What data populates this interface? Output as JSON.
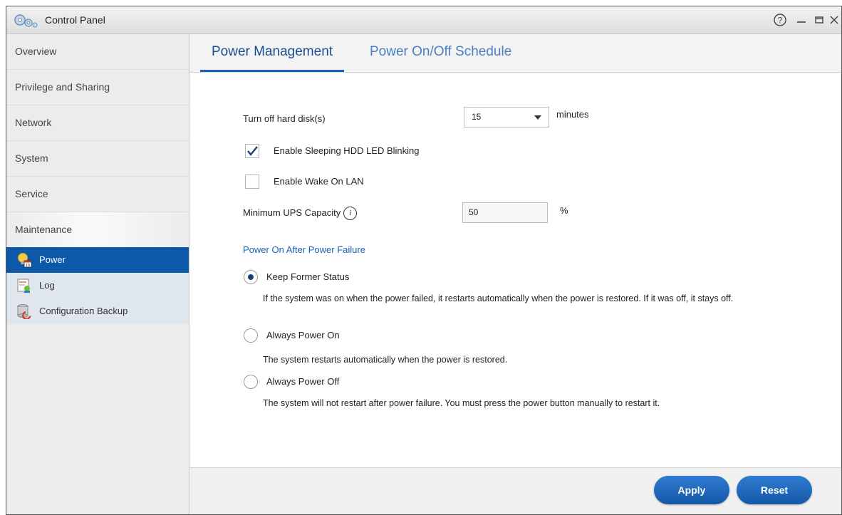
{
  "window": {
    "title": "Control Panel"
  },
  "sidebar": {
    "items": [
      {
        "label": "Overview"
      },
      {
        "label": "Privilege and Sharing"
      },
      {
        "label": "Network"
      },
      {
        "label": "System"
      },
      {
        "label": "Service"
      },
      {
        "label": "Maintenance"
      }
    ],
    "subitems": [
      {
        "label": "Power",
        "active": true
      },
      {
        "label": "Log"
      },
      {
        "label": "Configuration Backup"
      }
    ]
  },
  "tabs": [
    {
      "label": "Power Management",
      "active": true
    },
    {
      "label": "Power On/Off Schedule"
    }
  ],
  "form": {
    "hdd_label": "Turn off hard disk(s)",
    "hdd_value": "15",
    "hdd_unit": "minutes",
    "led_label": "Enable Sleeping HDD LED Blinking",
    "led_checked": true,
    "wol_label": "Enable Wake On LAN",
    "wol_checked": false,
    "ups_label": "Minimum UPS Capacity",
    "ups_info_glyph": "i",
    "ups_value": "50",
    "ups_unit": "%"
  },
  "power_failure": {
    "title": "Power On After Power Failure",
    "options": [
      {
        "label": "Keep Former Status",
        "selected": true,
        "desc": "If the system was on when the power failed, it restarts automatically when the power is restored. If it was off, it stays off."
      },
      {
        "label": "Always Power On",
        "selected": false,
        "desc": "The system restarts automatically when the power is restored."
      },
      {
        "label": "Always Power Off",
        "selected": false,
        "desc": "The system will not restart after power failure. You must press the power button manually to restart it."
      }
    ]
  },
  "buttons": {
    "apply": "Apply",
    "reset": "Reset"
  },
  "colors": {
    "accent": "#0b59a8",
    "link": "#1a62b5"
  }
}
